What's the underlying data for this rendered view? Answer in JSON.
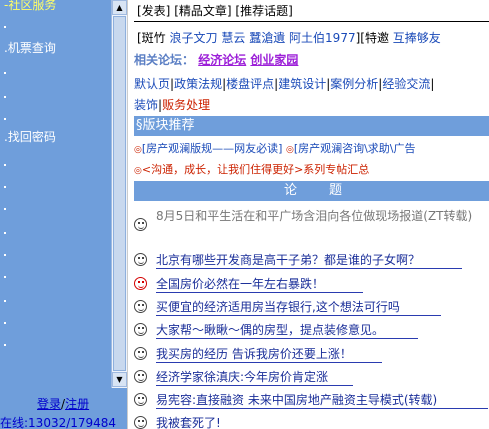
{
  "sidebar": {
    "items": [
      {
        "label": "-社区服务",
        "highlight": true
      },
      {
        "label": ".机票查询",
        "highlight": false
      },
      {
        "label": ".找回密码",
        "highlight": false
      }
    ],
    "login_label": "登录",
    "slash": "/",
    "register_label": "注册",
    "online_text": "在线:13032/179484"
  },
  "top_links": {
    "post": "[发表]",
    "featured": "[精品文章]",
    "recommend": "[推荐话题]"
  },
  "moderators": {
    "label": "[斑竹",
    "names": [
      "浪子文刀",
      "慧云",
      "蠶滄遺",
      "阿土伯1977"
    ],
    "special_label": "][特邀",
    "special_names": [
      "互捧够友"
    ]
  },
  "related": {
    "label": "相关论坛：",
    "links": [
      "经济论坛",
      "创业家园"
    ]
  },
  "categories": [
    {
      "label": "默认页",
      "style": "default"
    },
    {
      "label": "政策法规",
      "style": "normal"
    },
    {
      "label": "楼盘评点",
      "style": "normal"
    },
    {
      "label": "建筑设计",
      "style": "normal"
    },
    {
      "label": "案例分析",
      "style": "normal"
    },
    {
      "label": "经验交流",
      "style": "normal"
    },
    {
      "label": "装饰",
      "style": "normal"
    },
    {
      "label": "贩务处理",
      "style": "red"
    }
  ],
  "banner": "§版块推荐",
  "recommendations": [
    {
      "bullet": "◎",
      "text": "[房产观澜版规——网友必读]",
      "style": "normal"
    },
    {
      "bullet": "◎",
      "text": "[房产观澜咨询\\求助\\广告",
      "style": "normal"
    },
    {
      "bullet": "◎",
      "text": "<沟通，成长，让我们住得更好>系列专帖汇总",
      "style": "red"
    }
  ],
  "topics_header": "论　　题",
  "topics": [
    {
      "title": "8月5日和平生活在和平广场含泪向各位做现场报道(ZT转载)",
      "face": "dark",
      "dim": true
    },
    {
      "title": "北京有哪些开发商是高干子弟？都是谁的子女啊？",
      "face": "dark",
      "dim": false
    },
    {
      "title": "全国房价必然在一年左右暴跌！",
      "face": "red",
      "dim": false
    },
    {
      "title": "买便宜的经济适用房当存银行,这个想法可行吗",
      "face": "dark",
      "dim": false
    },
    {
      "title": "大家帮～瞅瞅～偶的房型，提点装修意见。",
      "face": "dark",
      "dim": false
    },
    {
      "title": "我买房的经历 告诉我房价还要上涨！",
      "face": "dark",
      "dim": false
    },
    {
      "title": "经济学家徐滇庆:今年房价肯定涨",
      "face": "dark",
      "dim": false
    },
    {
      "title": "易宪容:直接融资 未来中国房地产融资主导模式(转载)",
      "face": "dark",
      "dim": false
    },
    {
      "title": "我被套死了!",
      "face": "dark",
      "dim": false
    }
  ],
  "colors": {
    "sidebar_bg": "#6f9edb",
    "header_bg": "#6f9edb",
    "link_blue": "#1a4ab8",
    "accent_red": "#cc2200",
    "related_purple": "#9c1fd8"
  }
}
